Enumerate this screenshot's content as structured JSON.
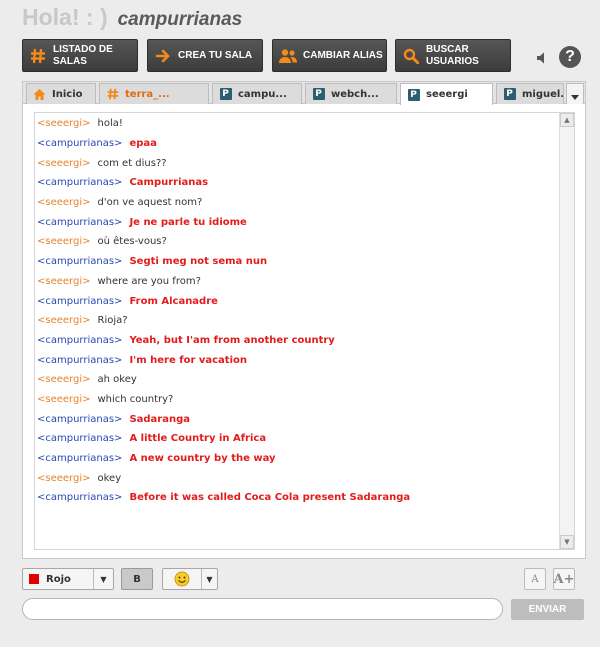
{
  "header": {
    "greeting": "Hola! : )",
    "username": "campurrianas"
  },
  "toolbar": {
    "buttons": [
      {
        "label": "LISTADO DE SALAS",
        "icon": "hash-icon"
      },
      {
        "label": "CREA TU SALA",
        "icon": "arrow-right-icon"
      },
      {
        "label": "CAMBIAR ALIAS",
        "icon": "users-icon"
      },
      {
        "label": "BUSCAR USUARIOS",
        "icon": "search-icon"
      }
    ],
    "speaker_icon": "speaker-icon",
    "help_label": "?"
  },
  "tabs": [
    {
      "label": "Inicio",
      "icon": "home-icon"
    },
    {
      "label": "terra_...",
      "icon": "hash-icon"
    },
    {
      "label": "campu...",
      "icon": "private-icon",
      "badge": "P"
    },
    {
      "label": "webch...",
      "icon": "private-icon",
      "badge": "P"
    },
    {
      "label": "seeergi",
      "icon": "private-icon",
      "badge": "P",
      "active": true
    },
    {
      "label": "miguel...",
      "icon": "private-icon",
      "badge": "P"
    }
  ],
  "messages": [
    {
      "nick": "<seeergi>",
      "text": "hola!",
      "who": "se"
    },
    {
      "nick": "<campurrianas>",
      "text": "epaa",
      "who": "ca"
    },
    {
      "nick": "<seeergi>",
      "text": "com et dius??",
      "who": "se"
    },
    {
      "nick": "<campurrianas>",
      "text": "Campurrianas",
      "who": "ca"
    },
    {
      "nick": "<seeergi>",
      "text": "d'on ve aquest nom?",
      "who": "se"
    },
    {
      "nick": "<campurrianas>",
      "text": "Je ne parle tu idiome",
      "who": "ca"
    },
    {
      "nick": "<seeergi>",
      "text": "où êtes-vous?",
      "who": "se"
    },
    {
      "nick": "<campurrianas>",
      "text": "Segti meg not sema nun",
      "who": "ca"
    },
    {
      "nick": "<seeergi>",
      "text": "where are you from?",
      "who": "se"
    },
    {
      "nick": "<campurrianas>",
      "text": "From Alcanadre",
      "who": "ca"
    },
    {
      "nick": "<seeergi>",
      "text": "Rioja?",
      "who": "se"
    },
    {
      "nick": "<campurrianas>",
      "text": "Yeah, but I'am from another country",
      "who": "ca"
    },
    {
      "nick": "<campurrianas>",
      "text": "I'm here for vacation",
      "who": "ca"
    },
    {
      "nick": "<seeergi>",
      "text": "ah okey",
      "who": "se"
    },
    {
      "nick": "<seeergi>",
      "text": "which country?",
      "who": "se"
    },
    {
      "nick": "<campurrianas>",
      "text": "Sadaranga",
      "who": "ca"
    },
    {
      "nick": "<campurrianas>",
      "text": "A little Country in Africa",
      "who": "ca"
    },
    {
      "nick": "<campurrianas>",
      "text": "A new country by the way",
      "who": "ca"
    },
    {
      "nick": "<seeergi>",
      "text": "okey",
      "who": "se"
    },
    {
      "nick": "<campurrianas>",
      "text": "Before it was called Coca Cola present Sadaranga",
      "who": "ca"
    }
  ],
  "format_bar": {
    "color_label": "Rojo",
    "color_value": "#e00000",
    "bold_label": "B",
    "font_small": "A",
    "font_large": "A+"
  },
  "input": {
    "value": "",
    "placeholder": ""
  },
  "send_label": "ENVIAR",
  "colors": {
    "own_nick": "#2a48b5",
    "other_nick": "#e8832a",
    "own_text": "#e41b1b",
    "toolbar_bg": "#474747",
    "accent": "#f28a1c"
  }
}
